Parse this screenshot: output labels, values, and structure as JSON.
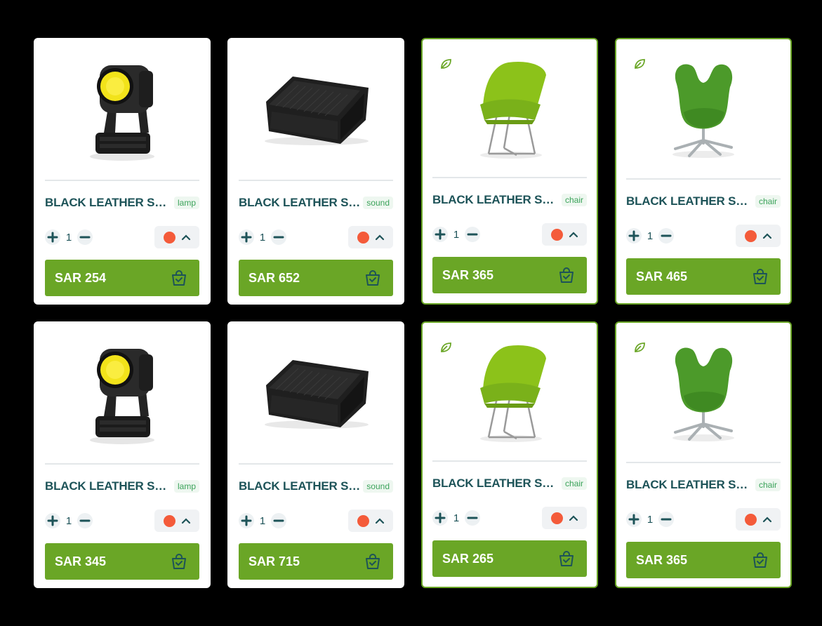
{
  "products": [
    {
      "title": "BLACK LEATHER ST...",
      "tag": "lamp",
      "qty": "1",
      "price": "SAR 254",
      "image": "moving-head-lamp",
      "eco": false
    },
    {
      "title": "BLACK LEATHER ST...",
      "tag": "sound",
      "qty": "1",
      "price": "SAR 652",
      "image": "stage-monitor-speaker",
      "eco": false
    },
    {
      "title": "BLACK LEATHER ST...",
      "tag": "chair",
      "qty": "1",
      "price": "SAR 365",
      "image": "lime-lounge-chair",
      "eco": true
    },
    {
      "title": "BLACK LEATHER ST...",
      "tag": "chair",
      "qty": "1",
      "price": "SAR 465",
      "image": "green-swan-chair",
      "eco": true
    },
    {
      "title": "BLACK LEATHER ST...",
      "tag": "lamp",
      "qty": "1",
      "price": "SAR 345",
      "image": "moving-head-lamp",
      "eco": false
    },
    {
      "title": "BLACK LEATHER ST...",
      "tag": "sound",
      "qty": "1",
      "price": "SAR 715",
      "image": "stage-monitor-speaker",
      "eco": false
    },
    {
      "title": "BLACK LEATHER ST...",
      "tag": "chair",
      "qty": "1",
      "price": "SAR 265",
      "image": "lime-lounge-chair",
      "eco": true
    },
    {
      "title": "BLACK LEATHER ST...",
      "tag": "chair",
      "qty": "1",
      "price": "SAR 365",
      "image": "green-swan-chair",
      "eco": true
    }
  ],
  "colors": {
    "accent": "#6aa626",
    "title": "#1d5358",
    "tag": "#3ba35a",
    "selected_color_swatch": "#f45b3a",
    "background": "#000000"
  },
  "icons": {
    "eco": "leaf-icon",
    "plus": "plus-icon",
    "minus": "minus-icon",
    "expand": "chevron-up-icon",
    "cart": "shopping-bag-icon"
  }
}
